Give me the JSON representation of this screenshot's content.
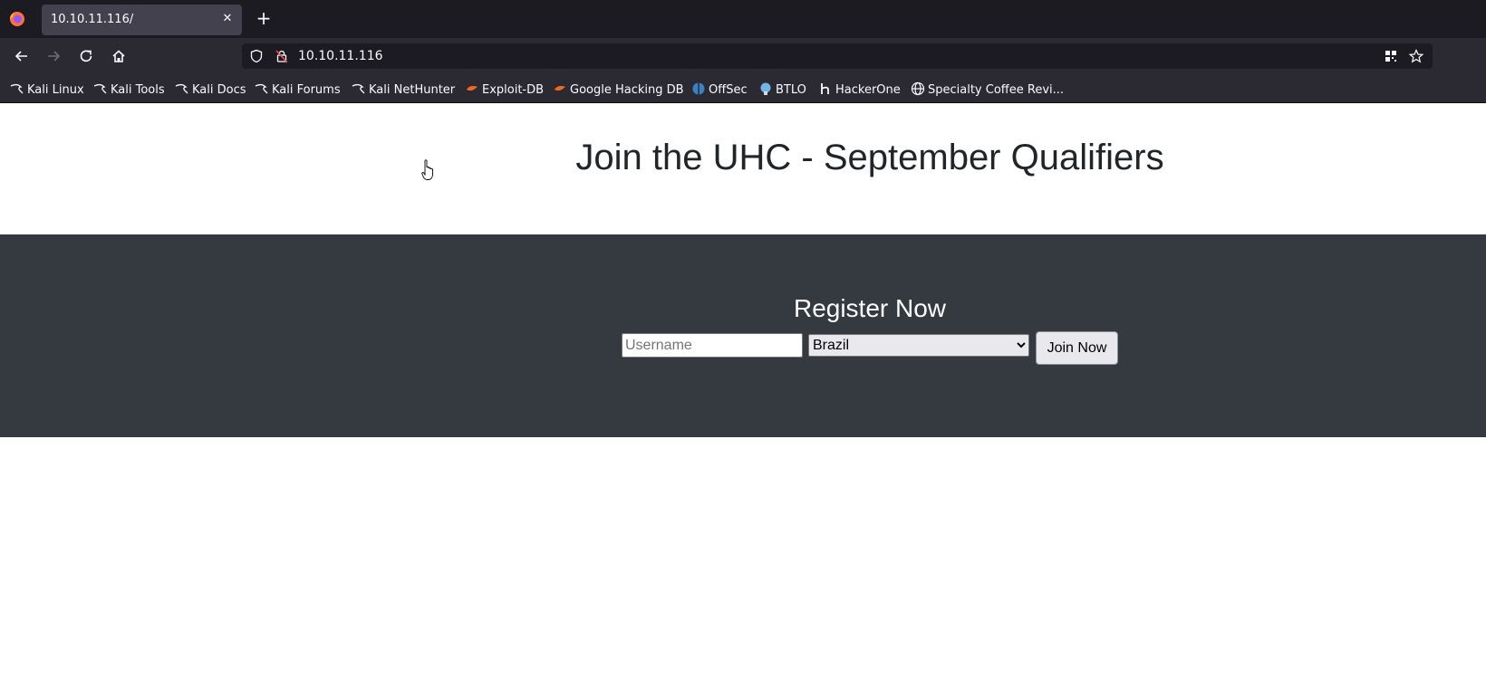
{
  "browser": {
    "tab_title": "10.10.11.116/",
    "tab_close": "✕",
    "new_tab": "+",
    "url": "10.10.11.116"
  },
  "bookmarks": [
    {
      "label": "Kali Linux",
      "icon": "kali-dragon-icon"
    },
    {
      "label": "Kali Tools",
      "icon": "kali-dragon-icon"
    },
    {
      "label": "Kali Docs",
      "icon": "kali-dragon-icon"
    },
    {
      "label": "Kali Forums",
      "icon": "kali-dragon-icon"
    },
    {
      "label": "Kali NetHunter",
      "icon": "kali-dragon-icon"
    },
    {
      "label": "Exploit-DB",
      "icon": "exploit-db-icon"
    },
    {
      "label": "Google Hacking DB",
      "icon": "exploit-db-icon"
    },
    {
      "label": "OffSec",
      "icon": "offsec-icon"
    },
    {
      "label": "BTLO",
      "icon": "btlo-icon"
    },
    {
      "label": "HackerOne",
      "icon": "hackerone-icon"
    },
    {
      "label": "Specialty Coffee Revi...",
      "icon": "globe-icon"
    }
  ],
  "page": {
    "heading": "Join the UHC - September Qualifiers",
    "register_title": "Register Now",
    "username_placeholder": "Username",
    "country_selected": "Brazil",
    "join_button": "Join Now"
  },
  "colors": {
    "band": "#343a40",
    "browser_chrome": "#2b2a33",
    "tabbar": "#1c1b22"
  }
}
